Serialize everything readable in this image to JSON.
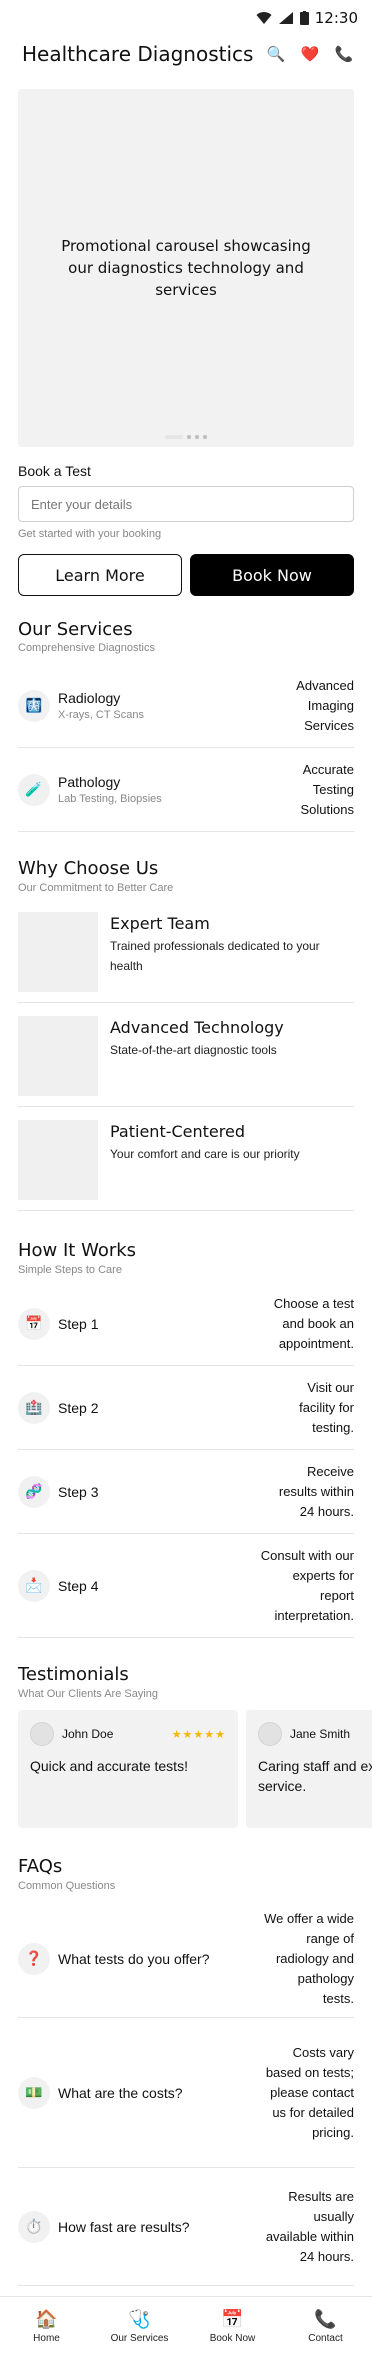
{
  "status_bar": {
    "time": "12:30",
    "wifi_icon": "wifi-icon",
    "signal_icon": "signal-icon",
    "battery_icon": "battery-icon"
  },
  "app_bar": {
    "title": "Healthcare Diagnostics",
    "actions": [
      {
        "icon": "search-icon",
        "glyph": "🔍"
      },
      {
        "icon": "heart-icon",
        "glyph": "❤️"
      },
      {
        "icon": "phone-icon",
        "glyph": "📞"
      }
    ]
  },
  "carousel": {
    "text": "Promotional carousel showcasing our diagnostics technology and services",
    "slide_count": 4,
    "active_slide": 1
  },
  "booking": {
    "label": "Book a Test",
    "input_placeholder": "Enter your details",
    "hint": "Get started with your booking",
    "learn_more": "Learn More",
    "book_now": "Book Now"
  },
  "services": {
    "title": "Our Services",
    "subtitle": "Comprehensive Diagnostics",
    "items": [
      {
        "icon": "xray-icon",
        "glyph": "🩻",
        "label": "Radiology",
        "sublabel": "X-rays, CT Scans",
        "right": "Advanced Imaging Services"
      },
      {
        "icon": "test-tube-icon",
        "glyph": "🧪",
        "label": "Pathology",
        "sublabel": "Lab Testing, Biopsies",
        "right": "Accurate Testing Solutions"
      }
    ]
  },
  "why": {
    "title": "Why Choose Us",
    "subtitle": "Our Commitment to Better Care",
    "items": [
      {
        "title": "Expert Team",
        "desc": "Trained professionals dedicated to your health"
      },
      {
        "title": "Advanced Technology",
        "desc": "State-of-the-art diagnostic tools"
      },
      {
        "title": "Patient-Centered",
        "desc": "Your comfort and care is our priority"
      }
    ]
  },
  "how": {
    "title": "How It Works",
    "subtitle": "Simple Steps to Care",
    "steps": [
      {
        "icon": "calendar-icon",
        "glyph": "📅",
        "label": "Step 1",
        "right": "Choose a test and book an appointment."
      },
      {
        "icon": "hospital-icon",
        "glyph": "🏥",
        "label": "Step 2",
        "right": "Visit our facility for testing."
      },
      {
        "icon": "dna-icon",
        "glyph": "🧬",
        "label": "Step 3",
        "right": "Receive results within 24 hours."
      },
      {
        "icon": "mail-icon",
        "glyph": "📩",
        "label": "Step 4",
        "right": "Consult with our experts for report interpretation."
      }
    ]
  },
  "testimonials": {
    "title": "Testimonials",
    "subtitle": "What Our Clients Are Saying",
    "items": [
      {
        "name": "John Doe",
        "stars": "★★★★★",
        "quote": "Quick and accurate tests!"
      },
      {
        "name": "Jane Smith",
        "stars": "",
        "quote": "Caring staff and excellent service."
      }
    ]
  },
  "faqs": {
    "title": "FAQs",
    "subtitle": "Common Questions",
    "items": [
      {
        "icon": "question-icon",
        "glyph": "❓",
        "question": "What tests do you offer?",
        "answer": "We offer a wide range of radiology and pathology tests."
      },
      {
        "icon": "money-icon",
        "glyph": "💵",
        "question": "What are the costs?",
        "answer": "Costs vary based on tests; please contact us for detailed pricing."
      },
      {
        "icon": "stopwatch-icon",
        "glyph": "⏱️",
        "question": "How fast are results?",
        "answer": "Results are usually available within 24 hours."
      }
    ]
  },
  "bottom_nav": [
    {
      "icon": "home-icon",
      "glyph": "🏠",
      "label": "Home"
    },
    {
      "icon": "stethoscope-icon",
      "glyph": "🩺",
      "label": "Our Services"
    },
    {
      "icon": "calendar-icon",
      "glyph": "📅",
      "label": "Book Now"
    },
    {
      "icon": "phone-icon",
      "glyph": "📞",
      "label": "Contact"
    }
  ]
}
